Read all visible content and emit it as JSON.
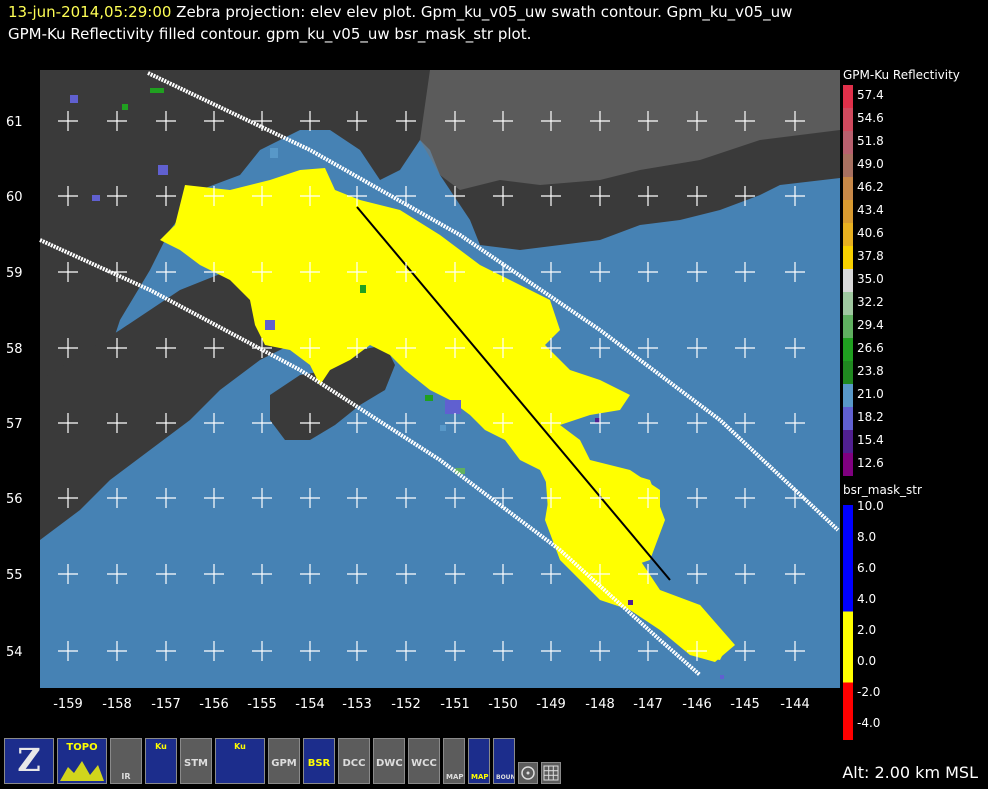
{
  "header": {
    "timestamp": "13-jun-2014,05:29:00",
    "line1_rest": "  Zebra projection: elev elev  plot.  Gpm_ku_v05_uw swath contour.  Gpm_ku_v05_uw",
    "line2": "GPM-Ku Reflectivity filled contour.  gpm_ku_v05_uw bsr_mask_str  plot."
  },
  "map": {
    "y_ticks": [
      "61",
      "60",
      "59",
      "58",
      "57",
      "56",
      "55",
      "54"
    ],
    "x_ticks": [
      "-159",
      "-158",
      "-157",
      "-156",
      "-155",
      "-154",
      "-153",
      "-152",
      "-151",
      "-150",
      "-149",
      "-148",
      "-147",
      "-146",
      "-145",
      "-144"
    ],
    "colors": {
      "ocean": "#4682b4",
      "land": "#3a3a3a",
      "echo": "#ffff00",
      "swath": "#ffffff"
    }
  },
  "legend_reflectivity": {
    "title": "GPM-Ku Reflectivity",
    "values": [
      "57.4",
      "54.6",
      "51.8",
      "49.0",
      "46.2",
      "43.4",
      "40.6",
      "37.8",
      "35.0",
      "32.2",
      "29.4",
      "26.6",
      "23.8",
      "21.0",
      "18.2",
      "15.4",
      "12.6"
    ],
    "colors": [
      "#e0304a",
      "#d04a5e",
      "#b8606e",
      "#a87060",
      "#c88848",
      "#d89a30",
      "#e8b020",
      "#f8d000",
      "#d8d8d8",
      "#a0c8a0",
      "#60b060",
      "#20a020",
      "#208820",
      "#5898c8",
      "#6060d0",
      "#502090",
      "#800080"
    ]
  },
  "legend_mask": {
    "title": "bsr_mask_str",
    "values": [
      "10.0",
      "8.0",
      "6.0",
      "4.0",
      "2.0",
      "0.0",
      "-2.0",
      "-4.0"
    ],
    "colors": [
      "#0000ff",
      "#0000ff",
      "#0000ff",
      "#ffff00",
      "#ffff00",
      "#ff0000",
      "#ff0000"
    ]
  },
  "toolbar": {
    "buttons": [
      {
        "label": "Z",
        "icon": "zebra-logo-icon"
      },
      {
        "label": "TOPO",
        "icon": "topo-icon"
      },
      {
        "label": "IR",
        "icon": "ir-icon"
      },
      {
        "label": "Ku",
        "icon": "ku-icon"
      },
      {
        "label": "STM",
        "icon": "stm-icon"
      },
      {
        "label": "Ku",
        "icon": "ku-v5-icon"
      },
      {
        "label": "GPM",
        "icon": "gpm-icon"
      },
      {
        "label": "BSR",
        "icon": "bsr-icon"
      },
      {
        "label": "DCC",
        "icon": "dcc-icon"
      },
      {
        "label": "DWC",
        "icon": "dwc-icon"
      },
      {
        "label": "WCC",
        "icon": "wcc-icon"
      },
      {
        "label": "MAP",
        "icon": "map-icon"
      },
      {
        "label": "MAP",
        "icon": "map-overlay-icon"
      },
      {
        "label": "BOUNDS",
        "icon": "bounds-icon"
      }
    ]
  },
  "status": {
    "altitude": "Alt: 2.00 km MSL"
  }
}
